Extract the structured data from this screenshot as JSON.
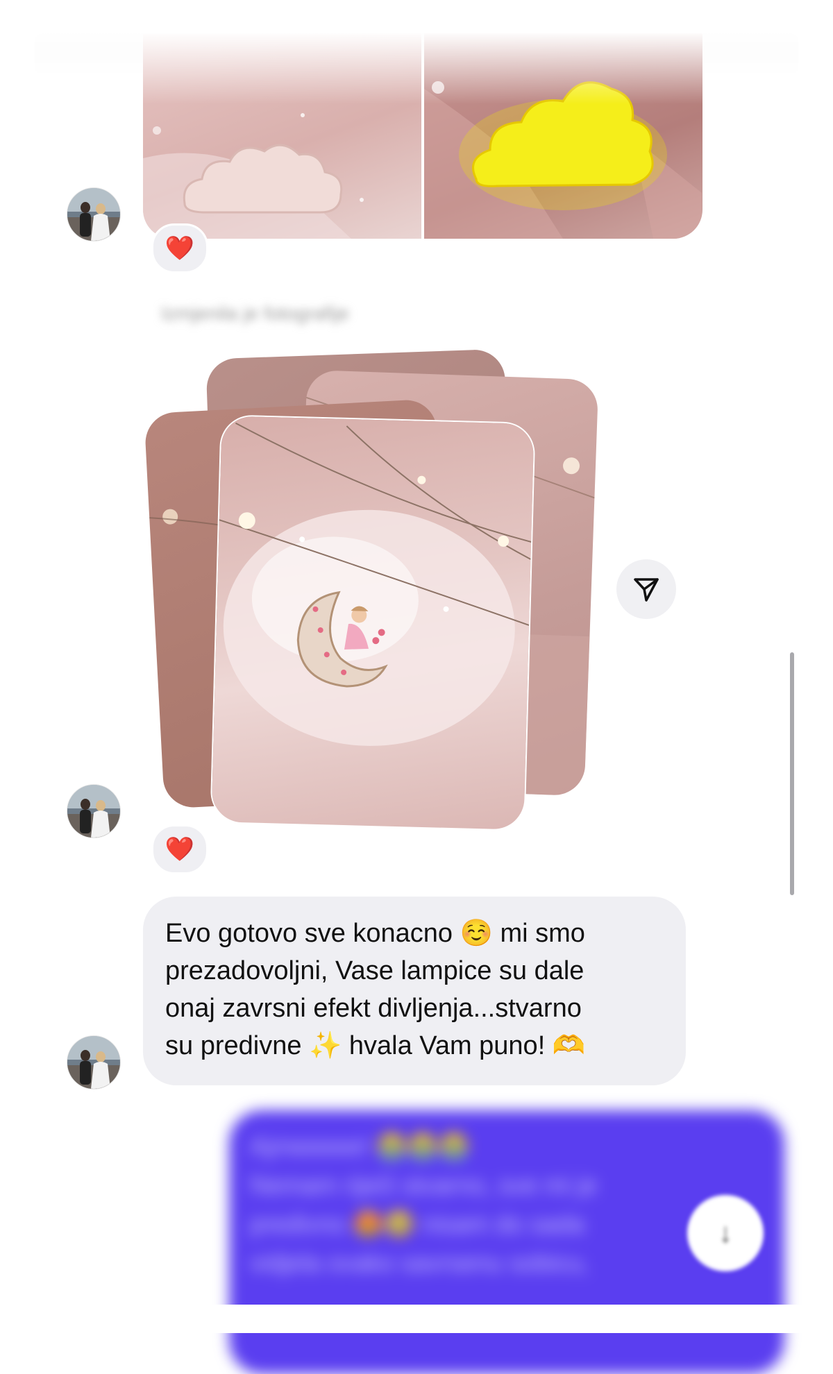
{
  "thread": {
    "photo_reaction": {
      "emoji": "❤️"
    },
    "album_caption": "Izmjenila je fotografije",
    "album_reaction": {
      "emoji": "❤️"
    },
    "message": {
      "lines": [
        "Evo gotovo sve konacno ☺️  mi smo",
        "prezadovoljni, Vase lampice su dale",
        "onaj zavrsni efekt divljenja...stvarno",
        "su predivne ✨  hvala Vam puno! 🫶"
      ]
    },
    "outgoing_message": {
      "lines": [
        "Ajmeeeee! 😭😭😭",
        "Nemam riječi stvarno, sve mi je",
        "predivno 😍🥹 nisam do sada",
        "vidjela ovako savrsenu sobicu,"
      ]
    }
  },
  "icons": {
    "avatar": "avatar-photo",
    "share": "paper-plane-icon",
    "scroll_down": "arrow-down-icon"
  },
  "colors": {
    "incoming_bubble": "#efeff3",
    "outgoing_bubble": "#5a3ef0",
    "heart": "#e0202d"
  }
}
